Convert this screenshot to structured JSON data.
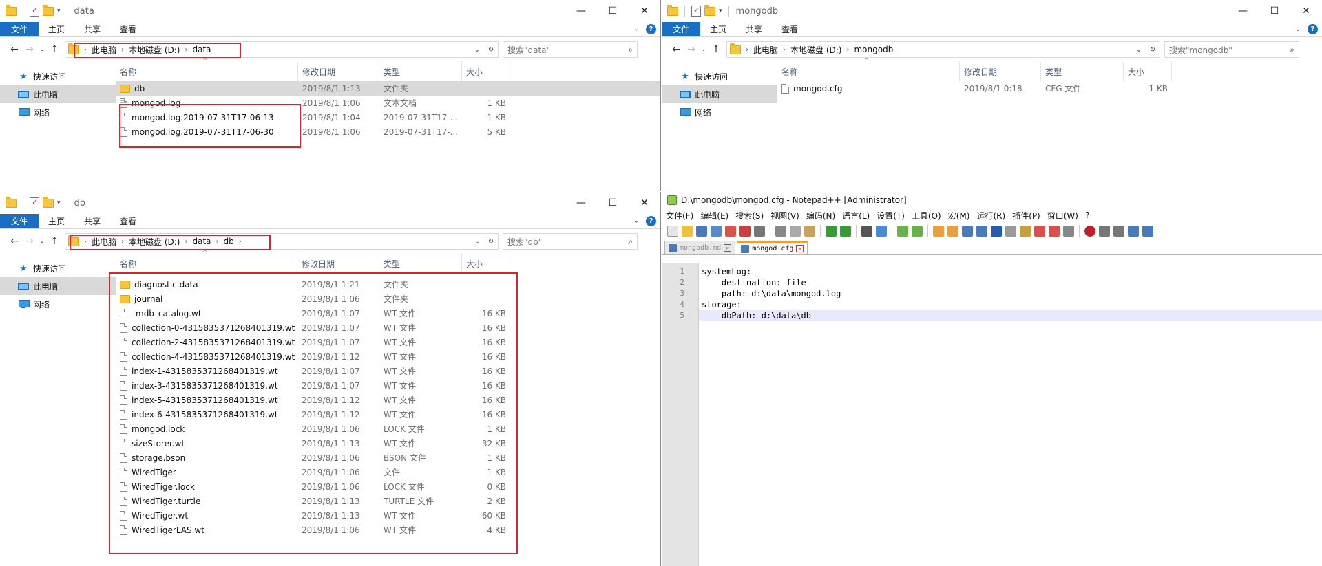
{
  "common": {
    "tabs": [
      "文件",
      "主页",
      "共享",
      "查看"
    ],
    "nav": [
      "快速访问",
      "此电脑",
      "网络"
    ],
    "cols": [
      "名称",
      "修改日期",
      "类型",
      "大小"
    ],
    "crumb_pc": "此电脑",
    "crumb_d": "本地磁盘 (D:)"
  },
  "win_data": {
    "title": "data",
    "crumb_last": "data",
    "search": "搜索\"data\"",
    "rows": [
      {
        "icon": "folder",
        "name": "db",
        "date": "2019/8/1 1:13",
        "type": "文件夹",
        "size": ""
      },
      {
        "icon": "text",
        "name": "mongod.log",
        "date": "2019/8/1 1:06",
        "type": "文本文档",
        "size": "1 KB"
      },
      {
        "icon": "file",
        "name": "mongod.log.2019-07-31T17-06-13",
        "date": "2019/8/1 1:04",
        "type": "2019-07-31T17-...",
        "size": "1 KB"
      },
      {
        "icon": "file",
        "name": "mongod.log.2019-07-31T17-06-30",
        "date": "2019/8/1 1:06",
        "type": "2019-07-31T17-...",
        "size": "5 KB"
      }
    ]
  },
  "win_mongodb": {
    "title": "mongodb",
    "crumb_last": "mongodb",
    "search": "搜索\"mongodb\"",
    "rows": [
      {
        "icon": "file",
        "name": "mongod.cfg",
        "date": "2019/8/1 0:18",
        "type": "CFG 文件",
        "size": "1 KB"
      }
    ]
  },
  "win_db": {
    "title": "db",
    "crumb_data": "data",
    "crumb_last": "db",
    "search": "搜索\"db\"",
    "rows": [
      {
        "icon": "folder",
        "name": "diagnostic.data",
        "date": "2019/8/1 1:21",
        "type": "文件夹",
        "size": ""
      },
      {
        "icon": "folder",
        "name": "journal",
        "date": "2019/8/1 1:06",
        "type": "文件夹",
        "size": ""
      },
      {
        "icon": "file",
        "name": "_mdb_catalog.wt",
        "date": "2019/8/1 1:07",
        "type": "WT 文件",
        "size": "16 KB"
      },
      {
        "icon": "file",
        "name": "collection-0-4315835371268401319.wt",
        "date": "2019/8/1 1:07",
        "type": "WT 文件",
        "size": "16 KB"
      },
      {
        "icon": "file",
        "name": "collection-2-4315835371268401319.wt",
        "date": "2019/8/1 1:07",
        "type": "WT 文件",
        "size": "16 KB"
      },
      {
        "icon": "file",
        "name": "collection-4-4315835371268401319.wt",
        "date": "2019/8/1 1:12",
        "type": "WT 文件",
        "size": "16 KB"
      },
      {
        "icon": "file",
        "name": "index-1-4315835371268401319.wt",
        "date": "2019/8/1 1:07",
        "type": "WT 文件",
        "size": "16 KB"
      },
      {
        "icon": "file",
        "name": "index-3-4315835371268401319.wt",
        "date": "2019/8/1 1:07",
        "type": "WT 文件",
        "size": "16 KB"
      },
      {
        "icon": "file",
        "name": "index-5-4315835371268401319.wt",
        "date": "2019/8/1 1:12",
        "type": "WT 文件",
        "size": "16 KB"
      },
      {
        "icon": "file",
        "name": "index-6-4315835371268401319.wt",
        "date": "2019/8/1 1:12",
        "type": "WT 文件",
        "size": "16 KB"
      },
      {
        "icon": "file",
        "name": "mongod.lock",
        "date": "2019/8/1 1:06",
        "type": "LOCK 文件",
        "size": "1 KB"
      },
      {
        "icon": "file",
        "name": "sizeStorer.wt",
        "date": "2019/8/1 1:13",
        "type": "WT 文件",
        "size": "32 KB"
      },
      {
        "icon": "file",
        "name": "storage.bson",
        "date": "2019/8/1 1:06",
        "type": "BSON 文件",
        "size": "1 KB"
      },
      {
        "icon": "file",
        "name": "WiredTiger",
        "date": "2019/8/1 1:06",
        "type": "文件",
        "size": "1 KB"
      },
      {
        "icon": "file",
        "name": "WiredTiger.lock",
        "date": "2019/8/1 1:06",
        "type": "LOCK 文件",
        "size": "0 KB"
      },
      {
        "icon": "file",
        "name": "WiredTiger.turtle",
        "date": "2019/8/1 1:13",
        "type": "TURTLE 文件",
        "size": "2 KB"
      },
      {
        "icon": "file",
        "name": "WiredTiger.wt",
        "date": "2019/8/1 1:13",
        "type": "WT 文件",
        "size": "60 KB"
      },
      {
        "icon": "file",
        "name": "WiredTigerLAS.wt",
        "date": "2019/8/1 1:06",
        "type": "WT 文件",
        "size": "4 KB"
      }
    ]
  },
  "npp": {
    "title": "D:\\mongodb\\mongod.cfg - Notepad++ [Administrator]",
    "menu": [
      "文件(F)",
      "编辑(E)",
      "搜索(S)",
      "视图(V)",
      "编码(N)",
      "语言(L)",
      "设置(T)",
      "工具(O)",
      "宏(M)",
      "运行(R)",
      "插件(P)",
      "窗口(W)",
      "?"
    ],
    "tabs": [
      {
        "label": "mongodb.md",
        "active": false
      },
      {
        "label": "mongod.cfg",
        "active": true
      }
    ],
    "lines": [
      "systemLog:",
      "    destination: file",
      "    path: d:\\data\\mongod.log",
      "storage:",
      "    dbPath: d:\\data\\db"
    ],
    "line_numbers": [
      "1",
      "2",
      "3",
      "4",
      "5"
    ]
  },
  "colors": {
    "accent": "#1a6fc4",
    "highlight": "#e0202a",
    "selected_row": "#d9d9d9"
  }
}
